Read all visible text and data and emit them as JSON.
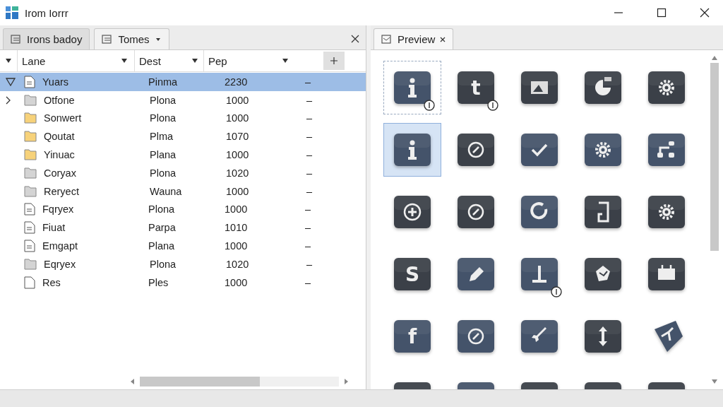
{
  "window": {
    "title": "Irom Iorrr"
  },
  "left_tabs": [
    {
      "label": "Irons badoy",
      "selected": true,
      "dropdown": false
    },
    {
      "label": "Tomes",
      "selected": false,
      "dropdown": true
    }
  ],
  "table": {
    "columns": [
      {
        "label": "Lane"
      },
      {
        "label": "Dest"
      },
      {
        "label": "Pep"
      }
    ],
    "rows": [
      {
        "name": "Yuars",
        "dest": "Pinma",
        "pep": "2230",
        "extra": "–",
        "kind": "doc",
        "expanded": true,
        "selected": true
      },
      {
        "name": "Otfone",
        "dest": "Plona",
        "pep": "1000",
        "extra": "–",
        "kind": "folder",
        "expanded": false,
        "selected": false
      },
      {
        "name": "Sonwert",
        "dest": "Plona",
        "pep": "1000",
        "extra": "–",
        "kind": "folder-yellow",
        "selected": false
      },
      {
        "name": "Qoutat",
        "dest": "Plma",
        "pep": "1070",
        "extra": "–",
        "kind": "folder-yellow",
        "selected": false
      },
      {
        "name": "Yinuac",
        "dest": "Plana",
        "pep": "1000",
        "extra": "–",
        "kind": "folder-yellow",
        "selected": false
      },
      {
        "name": "Coryax",
        "dest": "Plona",
        "pep": "1020",
        "extra": "–",
        "kind": "folder",
        "selected": false
      },
      {
        "name": "Reryect",
        "dest": "Wauna",
        "pep": "1000",
        "extra": "–",
        "kind": "folder",
        "selected": false
      },
      {
        "name": "Fqryex",
        "dest": "Plona",
        "pep": "1000",
        "extra": "–",
        "kind": "doc",
        "selected": false
      },
      {
        "name": "Fiuat",
        "dest": "Parpa",
        "pep": "1010",
        "extra": "–",
        "kind": "doc",
        "selected": false
      },
      {
        "name": "Emgapt",
        "dest": "Plana",
        "pep": "1000",
        "extra": "–",
        "kind": "doc",
        "selected": false
      },
      {
        "name": "Eqryex",
        "dest": "Plona",
        "pep": "1020",
        "extra": "–",
        "kind": "folder",
        "selected": false
      },
      {
        "name": "Res",
        "dest": "Ples",
        "pep": "1000",
        "extra": "–",
        "kind": "file",
        "selected": false
      }
    ]
  },
  "preview_tab": {
    "label": "Preview"
  },
  "icons": [
    {
      "kind": "info",
      "color": "#44536a",
      "selected": false,
      "focused": true,
      "badge": true
    },
    {
      "kind": "letter",
      "text": "t",
      "color": "#3b4048",
      "selected": false,
      "focused": false,
      "badge": true
    },
    {
      "kind": "image",
      "color": "#3b4048",
      "selected": false,
      "focused": false,
      "badge": false
    },
    {
      "kind": "pie",
      "color": "#3b4048",
      "selected": false,
      "focused": false,
      "badge": false
    },
    {
      "kind": "gear",
      "color": "#3b4048",
      "selected": false,
      "focused": false,
      "badge": false
    },
    {
      "kind": "info",
      "color": "#44536a",
      "selected": true,
      "focused": false,
      "badge": false
    },
    {
      "kind": "ring",
      "color": "#3b4048",
      "selected": false,
      "focused": false,
      "badge": false
    },
    {
      "kind": "check",
      "color": "#44536a",
      "selected": false,
      "focused": false,
      "badge": false
    },
    {
      "kind": "gear",
      "color": "#44536a",
      "selected": false,
      "focused": false,
      "badge": false
    },
    {
      "kind": "flow",
      "color": "#44536a",
      "selected": false,
      "focused": false,
      "badge": false
    },
    {
      "kind": "plus",
      "color": "#3b4048",
      "selected": false,
      "focused": false,
      "badge": false
    },
    {
      "kind": "ring",
      "color": "#3b4048",
      "selected": false,
      "focused": false,
      "badge": false
    },
    {
      "kind": "refresh",
      "color": "#44536a",
      "selected": false,
      "focused": false,
      "badge": false
    },
    {
      "kind": "page",
      "color": "#3b4048",
      "selected": false,
      "focused": false,
      "badge": false
    },
    {
      "kind": "gear",
      "color": "#3b4048",
      "selected": false,
      "focused": false,
      "badge": false
    },
    {
      "kind": "letter",
      "text": "S",
      "color": "#3b4048",
      "selected": false,
      "focused": false,
      "badge": false
    },
    {
      "kind": "pencil",
      "color": "#44536a",
      "selected": false,
      "focused": false,
      "badge": false
    },
    {
      "kind": "tee",
      "color": "#44536a",
      "selected": false,
      "focused": false,
      "badge": true
    },
    {
      "kind": "cube",
      "color": "#3b4048",
      "selected": false,
      "focused": false,
      "badge": false
    },
    {
      "kind": "calendar",
      "color": "#3b4048",
      "selected": false,
      "focused": false,
      "badge": false
    },
    {
      "kind": "letter",
      "text": "f",
      "color": "#44536a",
      "selected": false,
      "focused": false,
      "badge": false
    },
    {
      "kind": "ring",
      "color": "#44536a",
      "selected": false,
      "focused": false,
      "badge": false
    },
    {
      "kind": "rocket",
      "color": "#44536a",
      "selected": false,
      "focused": false,
      "badge": false
    },
    {
      "kind": "arrows",
      "color": "#3b4048",
      "selected": false,
      "focused": false,
      "badge": false
    },
    {
      "kind": "shield",
      "color": "#44536a",
      "selected": false,
      "focused": false,
      "badge": false
    },
    {
      "kind": "blank",
      "color": "#3b4048",
      "selected": false,
      "focused": false,
      "badge": false
    },
    {
      "kind": "blank",
      "color": "#44536a",
      "selected": false,
      "focused": false,
      "badge": false
    },
    {
      "kind": "blank",
      "color": "#3b4048",
      "selected": false,
      "focused": false,
      "badge": false
    },
    {
      "kind": "blank",
      "color": "#3b4048",
      "selected": false,
      "focused": false,
      "badge": false
    },
    {
      "kind": "blank",
      "color": "#3b4048",
      "selected": false,
      "focused": false,
      "badge": false
    }
  ]
}
